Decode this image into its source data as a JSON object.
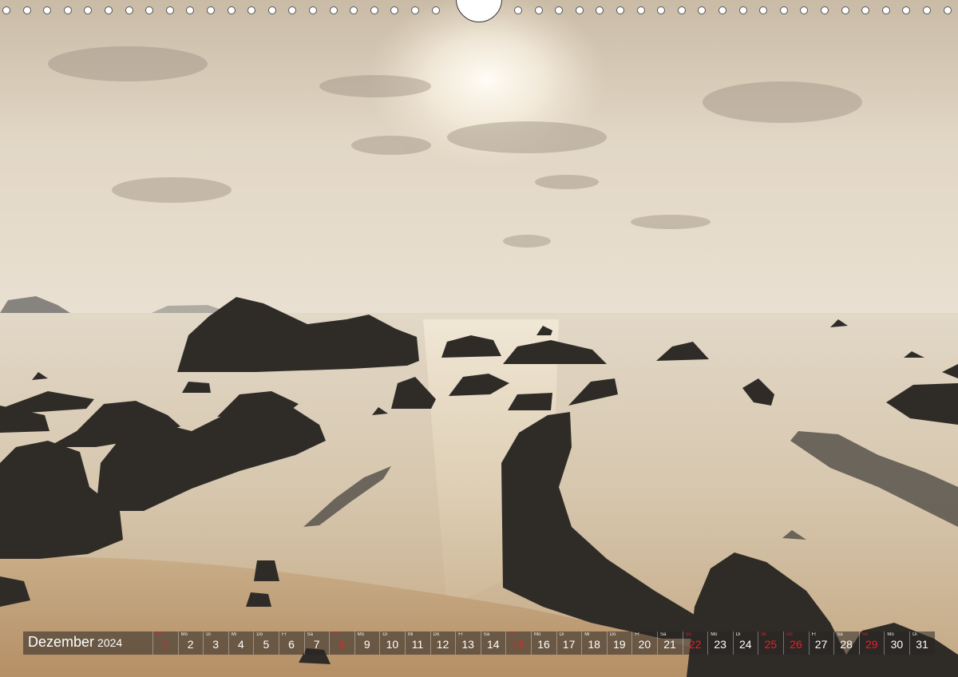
{
  "calendar": {
    "month": "Dezember",
    "year": "2024",
    "days": [
      {
        "wd": "So",
        "d": "1",
        "red": true
      },
      {
        "wd": "Mo",
        "d": "2"
      },
      {
        "wd": "Di",
        "d": "3"
      },
      {
        "wd": "Mi",
        "d": "4"
      },
      {
        "wd": "Do",
        "d": "5"
      },
      {
        "wd": "Fr",
        "d": "6"
      },
      {
        "wd": "Sa",
        "d": "7"
      },
      {
        "wd": "So",
        "d": "8",
        "red": true
      },
      {
        "wd": "Mo",
        "d": "9"
      },
      {
        "wd": "Di",
        "d": "10"
      },
      {
        "wd": "Mi",
        "d": "11"
      },
      {
        "wd": "Do",
        "d": "12"
      },
      {
        "wd": "Fr",
        "d": "13"
      },
      {
        "wd": "Sa",
        "d": "14"
      },
      {
        "wd": "So",
        "d": "15",
        "red": true
      },
      {
        "wd": "Mo",
        "d": "16"
      },
      {
        "wd": "Di",
        "d": "17"
      },
      {
        "wd": "Mi",
        "d": "18"
      },
      {
        "wd": "Do",
        "d": "19"
      },
      {
        "wd": "Fr",
        "d": "20"
      },
      {
        "wd": "Sa",
        "d": "21"
      },
      {
        "wd": "So",
        "d": "22",
        "red": true
      },
      {
        "wd": "Mo",
        "d": "23"
      },
      {
        "wd": "Di",
        "d": "24"
      },
      {
        "wd": "Mi",
        "d": "25",
        "red": true
      },
      {
        "wd": "Do",
        "d": "26",
        "red": true
      },
      {
        "wd": "Fr",
        "d": "27"
      },
      {
        "wd": "Sa",
        "d": "28"
      },
      {
        "wd": "So",
        "d": "29",
        "red": true
      },
      {
        "wd": "Mo",
        "d": "30"
      },
      {
        "wd": "Di",
        "d": "31"
      }
    ]
  },
  "colors": {
    "sky": "#e3d8c6",
    "sea": "#d9cbb3",
    "sand": "#c9ad87",
    "rock": "#2f2c28",
    "holiday_red": "#e8202a"
  }
}
